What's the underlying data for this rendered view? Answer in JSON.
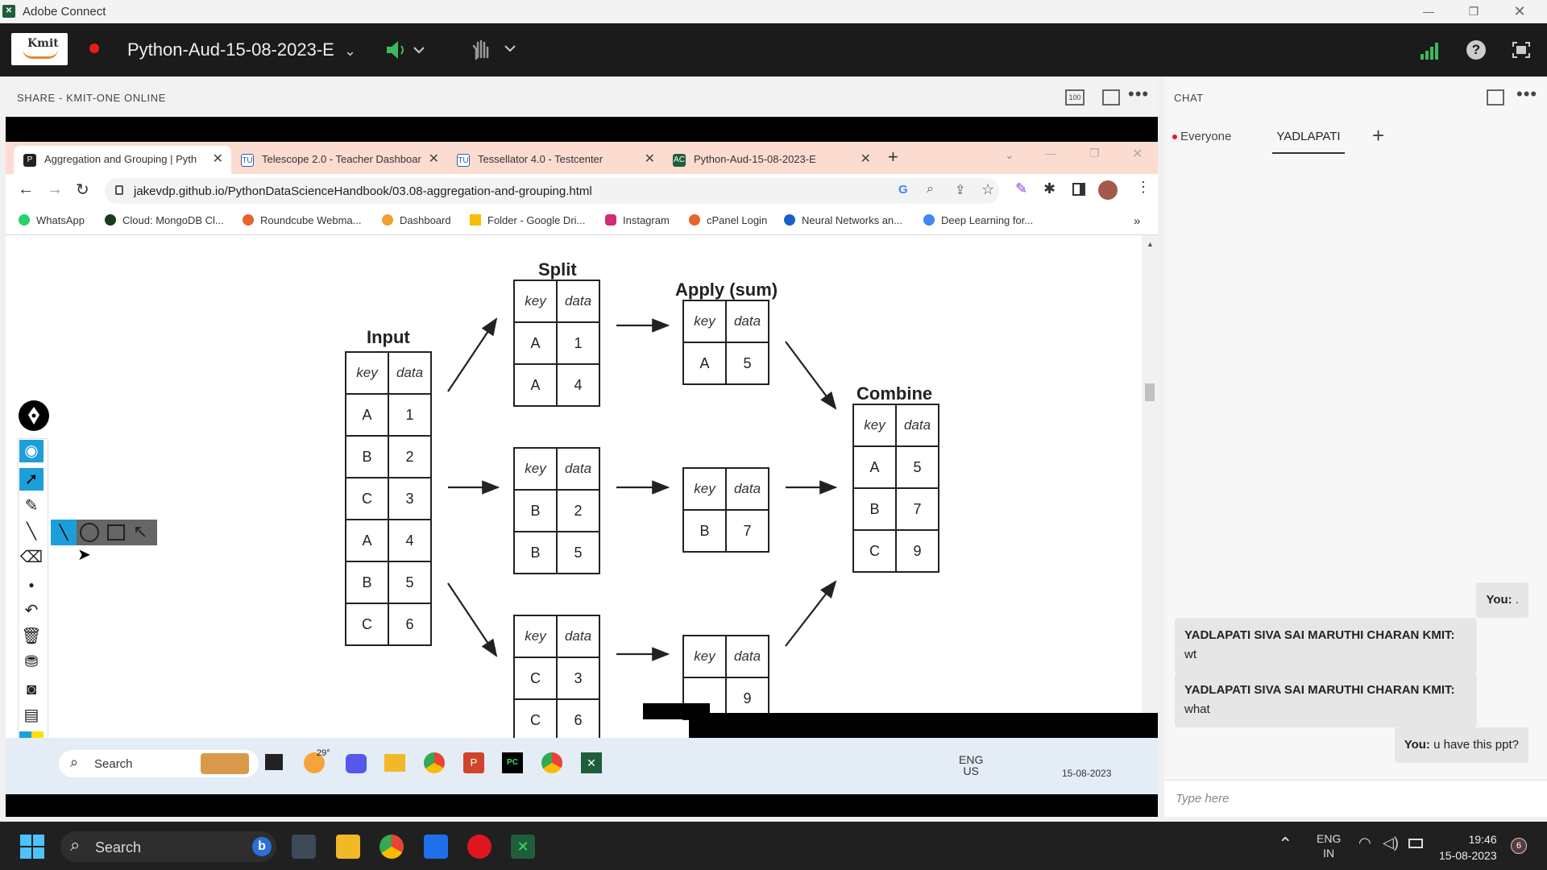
{
  "window": {
    "app_title": "Adobe Connect"
  },
  "toolbar": {
    "meeting_name": "Python-Aud-15-08-2023-E",
    "logo_text": "Kmit"
  },
  "share_pod": {
    "title": "SHARE  - KMIT-ONE ONLINE",
    "zoom_label": "100"
  },
  "browser": {
    "tabs": [
      {
        "label": "Aggregation and Grouping | Pyth",
        "favicon": "P",
        "color": "#222222"
      },
      {
        "label": "Telescope 2.0 - Teacher Dashboar",
        "favicon": "TU",
        "color": "#2b5fa8"
      },
      {
        "label": "Tessellator 4.0 - Testcenter",
        "favicon": "TU",
        "color": "#2b5fa8"
      },
      {
        "label": "Python-Aud-15-08-2023-E",
        "favicon": "AC",
        "color": "#1e5e3a"
      }
    ],
    "url": "jakevdp.github.io/PythonDataScienceHandbook/03.08-aggregation-and-grouping.html",
    "bookmarks": [
      {
        "label": "WhatsApp",
        "color": "#25d366"
      },
      {
        "label": "Cloud: MongoDB Cl...",
        "color": "#1b3b1b"
      },
      {
        "label": "Roundcube Webma...",
        "color": "#e8642a"
      },
      {
        "label": "Dashboard",
        "color": "#f0a030"
      },
      {
        "label": "Folder - Google Dri...",
        "color": "#fbbc04"
      },
      {
        "label": "Instagram",
        "color": "#d62976"
      },
      {
        "label": "cPanel Login",
        "color": "#e8642a"
      },
      {
        "label": "Neural Networks an...",
        "color": "#1a5fc8"
      },
      {
        "label": "Deep Learning for...",
        "color": "#4285f4"
      }
    ],
    "overflow": "»"
  },
  "diagram": {
    "labels": {
      "input": "Input",
      "split": "Split",
      "apply": "Apply (sum)",
      "combine": "Combine"
    },
    "header": {
      "key": "key",
      "data": "data"
    },
    "input_rows": [
      [
        "A",
        "1"
      ],
      [
        "B",
        "2"
      ],
      [
        "C",
        "3"
      ],
      [
        "A",
        "4"
      ],
      [
        "B",
        "5"
      ],
      [
        "C",
        "6"
      ]
    ],
    "split_a": [
      [
        "A",
        "1"
      ],
      [
        "A",
        "4"
      ]
    ],
    "split_b": [
      [
        "B",
        "2"
      ],
      [
        "B",
        "5"
      ]
    ],
    "split_c": [
      [
        "C",
        "3"
      ],
      [
        "C",
        "6"
      ]
    ],
    "apply_a": [
      [
        "A",
        "5"
      ]
    ],
    "apply_b": [
      [
        "B",
        "7"
      ]
    ],
    "apply_c_partial": "9",
    "combine_rows": [
      [
        "A",
        "5"
      ],
      [
        "B",
        "7"
      ],
      [
        "C",
        "9"
      ]
    ]
  },
  "inner_taskbar": {
    "search_label": "Search",
    "weather": "29°",
    "lang_top": "ENG",
    "lang_bottom": "US",
    "date": "15-08-2023"
  },
  "chat": {
    "title": "CHAT",
    "tabs": [
      "Everyone",
      "YADLAPATI"
    ],
    "add_symbol": "+",
    "messages": [
      {
        "from_self": true,
        "sender": "You:",
        "text": " ."
      },
      {
        "from_self": false,
        "sender": "YADLAPATI SIVA SAI MARUTHI CHARAN KMIT:",
        "text": "wt"
      },
      {
        "from_self": false,
        "sender": "YADLAPATI SIVA SAI MARUTHI CHARAN KMIT:",
        "text": "what"
      },
      {
        "from_self": true,
        "sender": "You:",
        "text": " u have this ppt?"
      }
    ],
    "input_placeholder": "Type here"
  },
  "taskbar": {
    "search_label": "Search",
    "lang_top": "ENG",
    "lang_bottom": "IN",
    "time": "19:46",
    "date": "15-08-2023",
    "notification_count": "6"
  },
  "colors": {
    "accent": "#1c9fd8",
    "record": "#e81b1b",
    "chat_dot": "#e81b1b"
  }
}
